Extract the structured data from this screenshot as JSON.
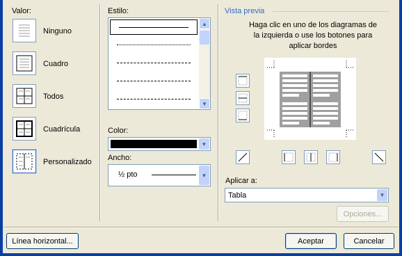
{
  "valor": {
    "label": "Valor:",
    "items": [
      {
        "label": "Ninguno",
        "icon": "border-none-icon"
      },
      {
        "label": "Cuadro",
        "icon": "border-box-icon"
      },
      {
        "label": "Todos",
        "icon": "border-all-icon"
      },
      {
        "label": "Cuadrícula",
        "icon": "border-grid-icon"
      },
      {
        "label": "Personalizado",
        "icon": "border-custom-icon",
        "selected": true
      }
    ]
  },
  "estilo": {
    "label": "Estilo:",
    "styles": [
      "solid",
      "dotted",
      "dashed-fine",
      "dashed",
      "dash-dot"
    ]
  },
  "color": {
    "label": "Color:",
    "value": "#000000"
  },
  "ancho": {
    "label": "Ancho:",
    "value": "½ pto"
  },
  "preview": {
    "label": "Vista previa",
    "hint": "Haga clic en uno de los diagramas de la izquierda o use los botones para aplicar bordes"
  },
  "aplicar": {
    "label": "Aplicar a:",
    "value": "Tabla"
  },
  "buttons": {
    "opciones": "Opciones...",
    "linea": "Línea horizontal...",
    "aceptar": "Aceptar",
    "cancelar": "Cancelar"
  },
  "colors": {
    "accent": "#316ac5",
    "frame": "#0a3ea5",
    "face": "#ece9d8"
  }
}
